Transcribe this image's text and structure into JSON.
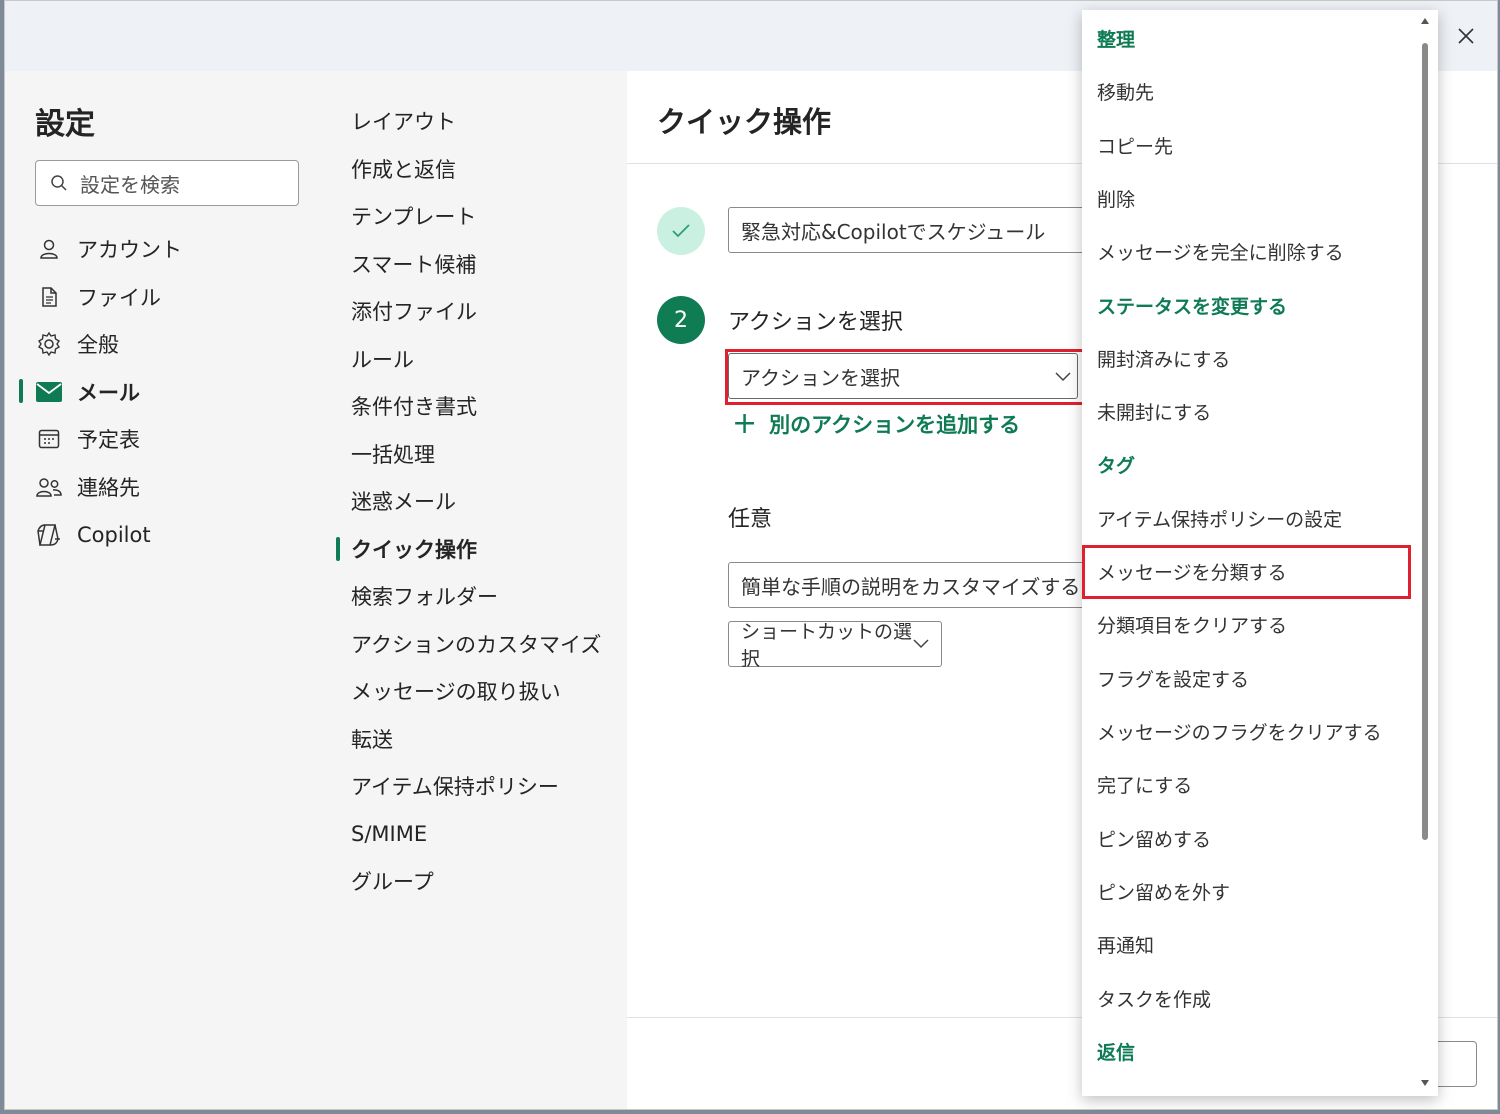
{
  "settings": {
    "title": "設定",
    "search_placeholder": "設定を検索",
    "nav": [
      {
        "label": "アカウント",
        "icon": "person-icon"
      },
      {
        "label": "ファイル",
        "icon": "file-icon"
      },
      {
        "label": "全般",
        "icon": "gear-icon"
      },
      {
        "label": "メール",
        "icon": "mail-icon",
        "active": true
      },
      {
        "label": "予定表",
        "icon": "calendar-icon"
      },
      {
        "label": "連絡先",
        "icon": "people-icon"
      },
      {
        "label": "Copilot",
        "icon": "copilot-icon"
      }
    ]
  },
  "mail_nav": {
    "items": [
      "レイアウト",
      "作成と返信",
      "テンプレート",
      "スマート候補",
      "添付ファイル",
      "ルール",
      "条件付き書式",
      "一括処理",
      "迷惑メール",
      "クイック操作",
      "検索フォルダー",
      "アクションのカスタマイズ",
      "メッセージの取り扱い",
      "転送",
      "アイテム保持ポリシー",
      "S/MIME",
      "グループ"
    ],
    "active": "クイック操作"
  },
  "content": {
    "title": "クイック操作",
    "step_1_value": "緊急対応&Copilotでスケジュール",
    "step_2_number": "2",
    "step_2_label": "アクションを選択",
    "action_select_value": "アクションを選択",
    "add_action_label": "別のアクションを追加する",
    "optional_label": "任意",
    "description_placeholder": "簡単な手順の説明をカスタマイズする",
    "shortcut_label": "ショートカットの選択"
  },
  "dropdown": {
    "highlighted": "メッセージを分類する",
    "rows": [
      {
        "type": "header",
        "label": "整理"
      },
      {
        "type": "item",
        "label": "移動先"
      },
      {
        "type": "item",
        "label": "コピー先"
      },
      {
        "type": "item",
        "label": "削除"
      },
      {
        "type": "item",
        "label": "メッセージを完全に削除する"
      },
      {
        "type": "header",
        "label": "ステータスを変更する"
      },
      {
        "type": "item",
        "label": "開封済みにする"
      },
      {
        "type": "item",
        "label": "未開封にする"
      },
      {
        "type": "header",
        "label": "タグ"
      },
      {
        "type": "item",
        "label": "アイテム保持ポリシーの設定"
      },
      {
        "type": "item",
        "label": "メッセージを分類する"
      },
      {
        "type": "item",
        "label": "分類項目をクリアする"
      },
      {
        "type": "item",
        "label": "フラグを設定する"
      },
      {
        "type": "item",
        "label": "メッセージのフラグをクリアする"
      },
      {
        "type": "item",
        "label": "完了にする"
      },
      {
        "type": "item",
        "label": "ピン留めする"
      },
      {
        "type": "item",
        "label": "ピン留めを外す"
      },
      {
        "type": "item",
        "label": "再通知"
      },
      {
        "type": "item",
        "label": "タスクを作成"
      },
      {
        "type": "header",
        "label": "返信"
      }
    ]
  },
  "colors": {
    "accent": "#0f7b54",
    "highlight_border": "#e0202e"
  }
}
